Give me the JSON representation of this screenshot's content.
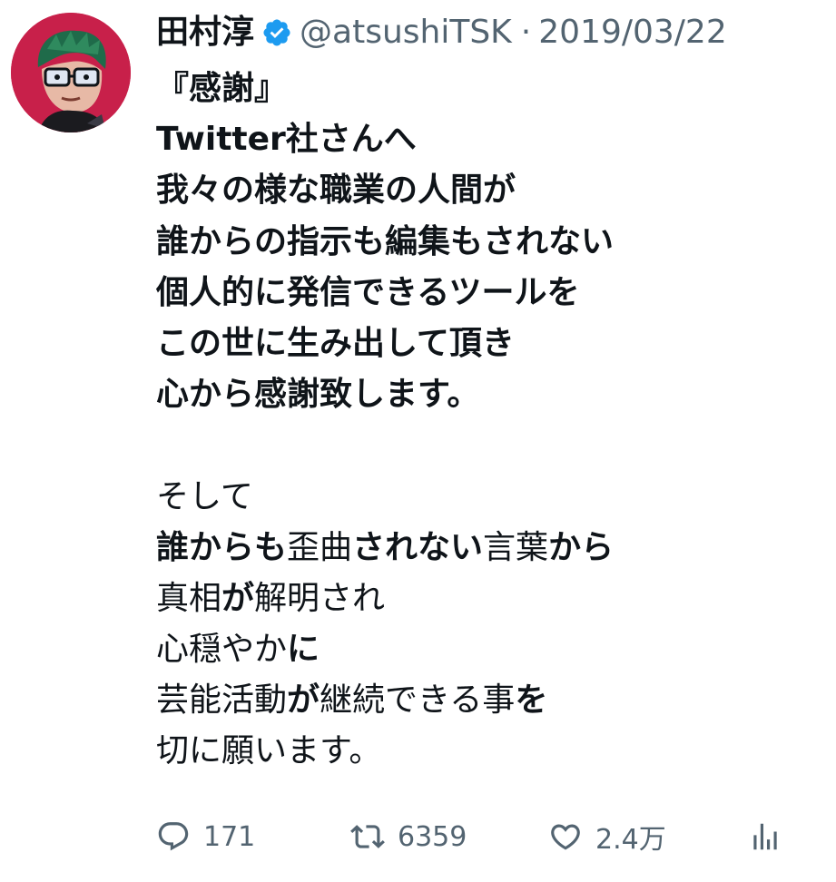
{
  "author": {
    "display_name": "田村淳",
    "handle": "@atsushiTSK",
    "separator": "·",
    "date": "2019/03/22",
    "verified_color": "#1d9bf0"
  },
  "tweet": {
    "lines": [
      [
        {
          "text": "『感謝』",
          "bold": true
        }
      ],
      [
        {
          "text": "Twitter社さんへ",
          "bold": true
        }
      ],
      [
        {
          "text": "我々の様な職業の人間が",
          "bold": true
        }
      ],
      [
        {
          "text": "誰からの指示も編集もされない",
          "bold": true
        }
      ],
      [
        {
          "text": "個人的に発信できるツールを",
          "bold": true
        }
      ],
      [
        {
          "text": "この世に生み出して頂き",
          "bold": true
        }
      ],
      [
        {
          "text": "心から感謝致します。",
          "bold": true
        }
      ],
      [],
      [
        {
          "text": "そして",
          "bold": false
        }
      ],
      [
        {
          "text": "誰からも",
          "bold": true
        },
        {
          "text": "歪曲",
          "bold": false
        },
        {
          "text": "されない",
          "bold": true
        },
        {
          "text": "言葉",
          "bold": false
        },
        {
          "text": "から",
          "bold": true
        }
      ],
      [
        {
          "text": "真相",
          "bold": false
        },
        {
          "text": "が",
          "bold": true
        },
        {
          "text": "解明され",
          "bold": false
        }
      ],
      [
        {
          "text": "心穏やか",
          "bold": false
        },
        {
          "text": "に",
          "bold": true
        }
      ],
      [
        {
          "text": "芸能活動",
          "bold": false
        },
        {
          "text": "が",
          "bold": true
        },
        {
          "text": "継続できる事",
          "bold": false
        },
        {
          "text": "を",
          "bold": true
        }
      ],
      [
        {
          "text": "切に願います。",
          "bold": false
        }
      ]
    ]
  },
  "actions": {
    "reply_count": "171",
    "retweet_count": "6359",
    "like_count": "2.4万",
    "icons": {
      "reply": "reply-icon",
      "retweet": "retweet-icon",
      "like": "heart-icon",
      "views": "analytics-icon"
    },
    "icon_color": "#536471"
  },
  "colors": {
    "text": "#0f1419",
    "secondary": "#536471",
    "avatar_bg": "#c8204a"
  }
}
